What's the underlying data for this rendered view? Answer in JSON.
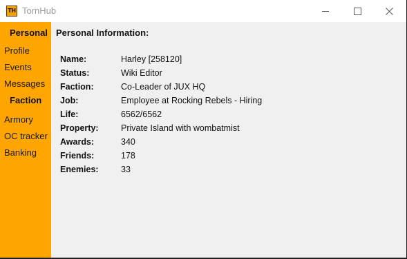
{
  "window": {
    "title": "TornHub",
    "icon_text": "TH",
    "icon_color": "#f5a000"
  },
  "sidebar": {
    "color": "#ffa500",
    "personal_header": "Personal",
    "personal_items": [
      "Profile",
      "Events",
      "Messages"
    ],
    "faction_header": "Faction",
    "faction_items": [
      "Armory",
      "OC tracker",
      "Banking"
    ]
  },
  "main": {
    "section_title": "Personal Information:",
    "info": [
      {
        "label": "Name:",
        "value": "Harley [258120]"
      },
      {
        "label": "Status:",
        "value": "Wiki Editor"
      },
      {
        "label": "Faction:",
        "value": "Co-Leader of JUX HQ"
      },
      {
        "label": "Job:",
        "value": "Employee at Rocking Rebels - Hiring"
      },
      {
        "label": "Life:",
        "value": "6562/6562"
      },
      {
        "label": "Property:",
        "value": "Private Island with wombatmist"
      },
      {
        "label": "Awards:",
        "value": "340"
      },
      {
        "label": "Friends:",
        "value": "178"
      },
      {
        "label": "Enemies:",
        "value": "33"
      }
    ]
  }
}
